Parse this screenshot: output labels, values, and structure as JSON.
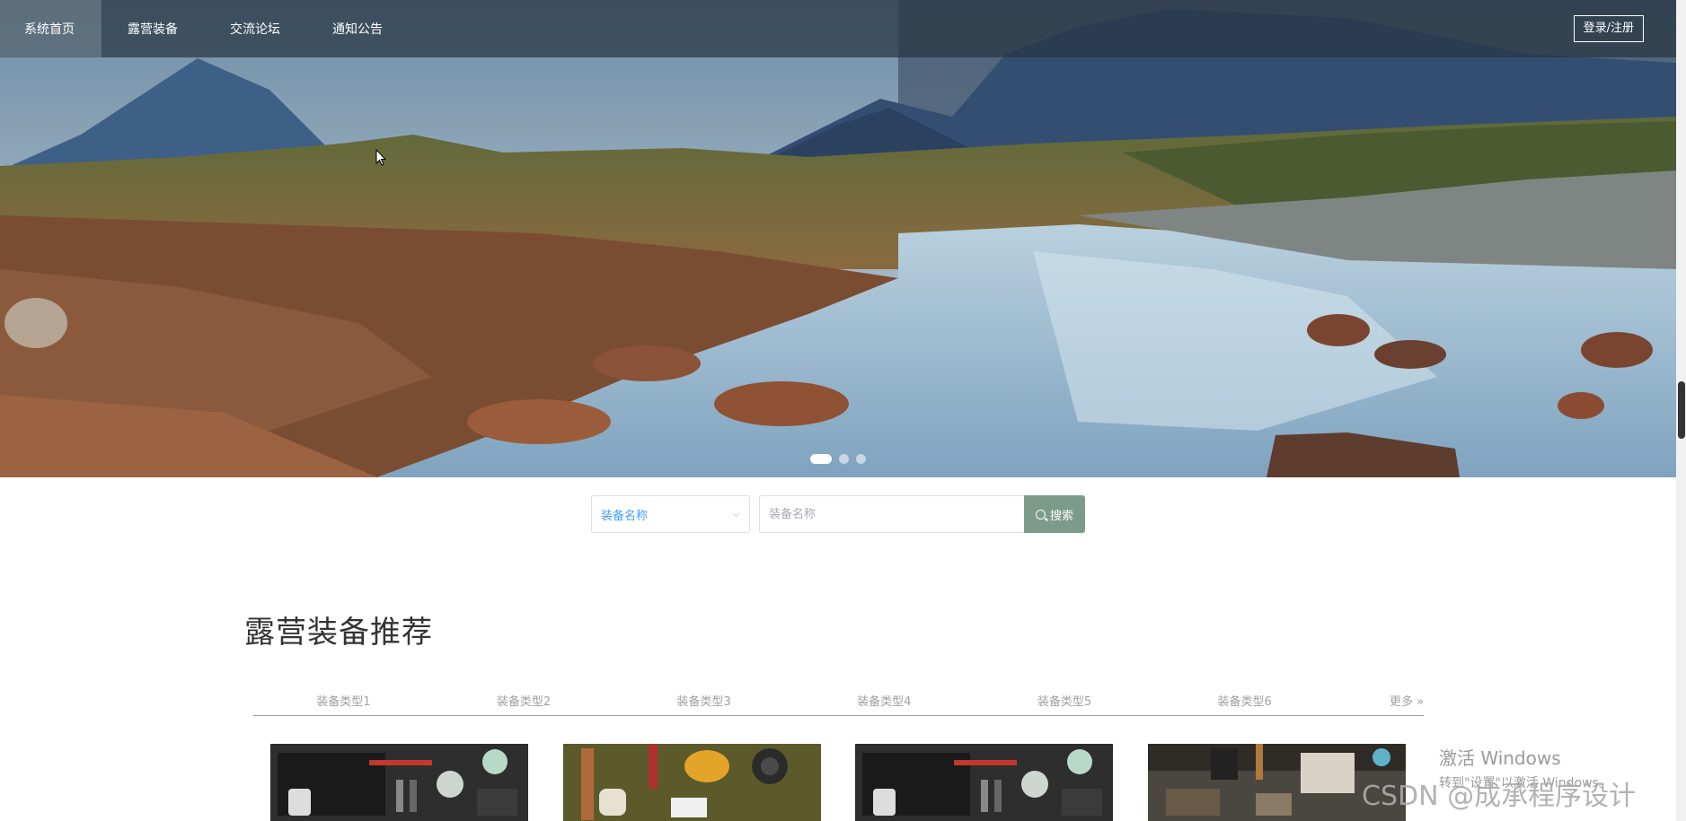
{
  "nav": {
    "items": [
      {
        "label": "系统首页",
        "active": true
      },
      {
        "label": "露营装备",
        "active": false
      },
      {
        "label": "交流论坛",
        "active": false
      },
      {
        "label": "通知公告",
        "active": false
      }
    ],
    "login_label": "登录/注册"
  },
  "carousel": {
    "slide_count": 3,
    "active_index": 0
  },
  "search": {
    "field_select_value": "装备名称",
    "input_placeholder": "装备名称",
    "button_label": "搜索",
    "accent_color": "#7d9b8b"
  },
  "section": {
    "title": "露营装备推荐",
    "tabs": [
      "装备类型1",
      "装备类型2",
      "装备类型3",
      "装备类型4",
      "装备类型5",
      "装备类型6"
    ],
    "more_label": "更多 »"
  },
  "products": [
    {
      "image": "camping gear flat-lay"
    },
    {
      "image": "tools and gloves on green cloth"
    },
    {
      "image": "camping gear flat-lay"
    },
    {
      "image": "camping storage room"
    }
  ],
  "watermark": {
    "activate_title": "激活 Windows",
    "activate_sub": "转到\"设置\"以激活 Windows。",
    "csdn": "CSDN @成承程序设计"
  }
}
